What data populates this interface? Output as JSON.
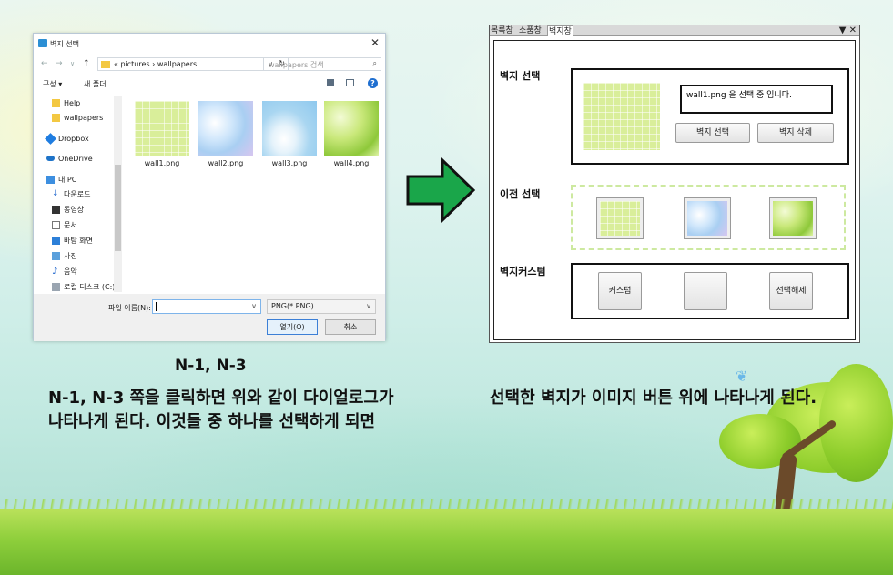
{
  "dialog": {
    "title": "벽지 선택",
    "nav": {
      "back": "←",
      "forward": "→",
      "recent": "∨",
      "up": "↑"
    },
    "address": {
      "path": "« pictures › wallpapers",
      "dropdown": "∨",
      "refresh": "↻"
    },
    "search_placeholder": "wallpapers 검색",
    "toolbar": {
      "organize": "구성 ▾",
      "new_folder": "새 폴더",
      "help": "?"
    },
    "sidebar": [
      {
        "label": "Help",
        "icon": "folder-icon"
      },
      {
        "label": "wallpapers",
        "icon": "folder-icon"
      },
      {
        "label": "Dropbox",
        "icon": "dropbox-icon"
      },
      {
        "label": "OneDrive",
        "icon": "onedrive-icon"
      },
      {
        "label": "내 PC",
        "icon": "pc-icon"
      },
      {
        "label": "다운로드",
        "icon": "download-icon"
      },
      {
        "label": "동영상",
        "icon": "video-icon"
      },
      {
        "label": "문서",
        "icon": "document-icon"
      },
      {
        "label": "바탕 화면",
        "icon": "desktop-icon"
      },
      {
        "label": "사진",
        "icon": "pictures-icon"
      },
      {
        "label": "음악",
        "icon": "music-icon"
      },
      {
        "label": "로컬 디스크 (C:)",
        "icon": "disk-icon"
      }
    ],
    "files": [
      {
        "name": "wall1.png"
      },
      {
        "name": "wall2.png"
      },
      {
        "name": "wall3.png"
      },
      {
        "name": "wall4.png"
      }
    ],
    "filename_label": "파일 이름(N):",
    "filename_value": "",
    "filetype": "PNG(*.PNG)",
    "open_button": "열기(O)",
    "cancel_button": "취소"
  },
  "app": {
    "tabs": [
      "목록창",
      "소품창",
      "벽지창"
    ],
    "active_tab": "벽지창",
    "controls": "▼ ✕",
    "sections": {
      "wallpaper_select": {
        "label": "벽지 선택",
        "status": "wall1.png 을 선택 중 입니다.",
        "select_button": "벽지 선택",
        "delete_button": "벽지 삭제"
      },
      "previous": {
        "label": "이전 선택"
      },
      "custom": {
        "label": "벽지커스텀",
        "custom_button": "커스텀",
        "blank_button": "",
        "deselect_button": "선택해제"
      }
    }
  },
  "captions": {
    "title": "N-1, N-3",
    "left": "N-1, N-3 쪽을 클릭하면 위와 같이 다이얼로그가 나타나게 된다. 이것들 중 하나를 선택하게 되면",
    "right": "선택한 벽지가 이미지 버튼 위에 나타나게 된다."
  },
  "colors": {
    "arrow_fill": "#1aa64a",
    "arrow_stroke": "#111111",
    "dialog_accent": "#3c7fd6"
  }
}
